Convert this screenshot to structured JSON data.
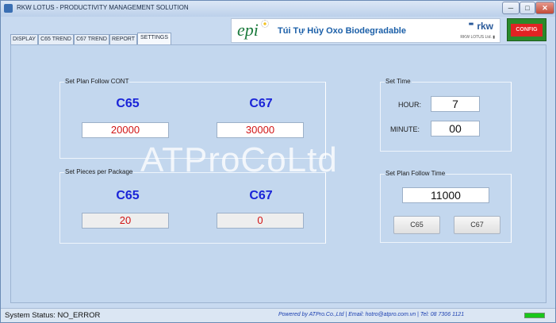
{
  "window": {
    "title": "RKW LOTUS - PRODUCTIVITY MANAGEMENT SOLUTION",
    "minimize": "─",
    "maximize": "□",
    "close": "✕"
  },
  "tabs": [
    {
      "label": "DISPLAY"
    },
    {
      "label": "C65 TREND"
    },
    {
      "label": "C67 TREND"
    },
    {
      "label": "REPORT"
    },
    {
      "label": "SETTINGS"
    }
  ],
  "banner": {
    "logo": "epi",
    "slogan": "Túi Tự Hủy Oxo Biodegradable",
    "brand": "rkw",
    "brand_dots": "■■\n■■",
    "sub": "RKW LOTUS Ltd. ▮"
  },
  "config_button": "CONFIG",
  "plan_cont": {
    "label": "Set Plan Follow CONT",
    "m1": "C65",
    "m2": "C67",
    "v1": "20000",
    "v2": "30000"
  },
  "pieces": {
    "label": "Set Pieces per Package",
    "m1": "C65",
    "m2": "C67",
    "v1": "20",
    "v2": "0"
  },
  "set_time": {
    "label": "Set Time",
    "hour_label": "HOUR:",
    "hour": "7",
    "minute_label": "MINUTE:",
    "minute": "00"
  },
  "plan_time": {
    "label": "Set Plan Follow Time",
    "value": "11000",
    "btn1": "C65",
    "btn2": "C67"
  },
  "watermark": "ATProCoLtd",
  "status": {
    "text": "System Status: NO_ERROR",
    "credit": "Powered by ATPro.Co.,Ltd | Email: hotro@atpro.com.vn | Tel: 08 7306 1121",
    "led_color": "#19c71a"
  }
}
